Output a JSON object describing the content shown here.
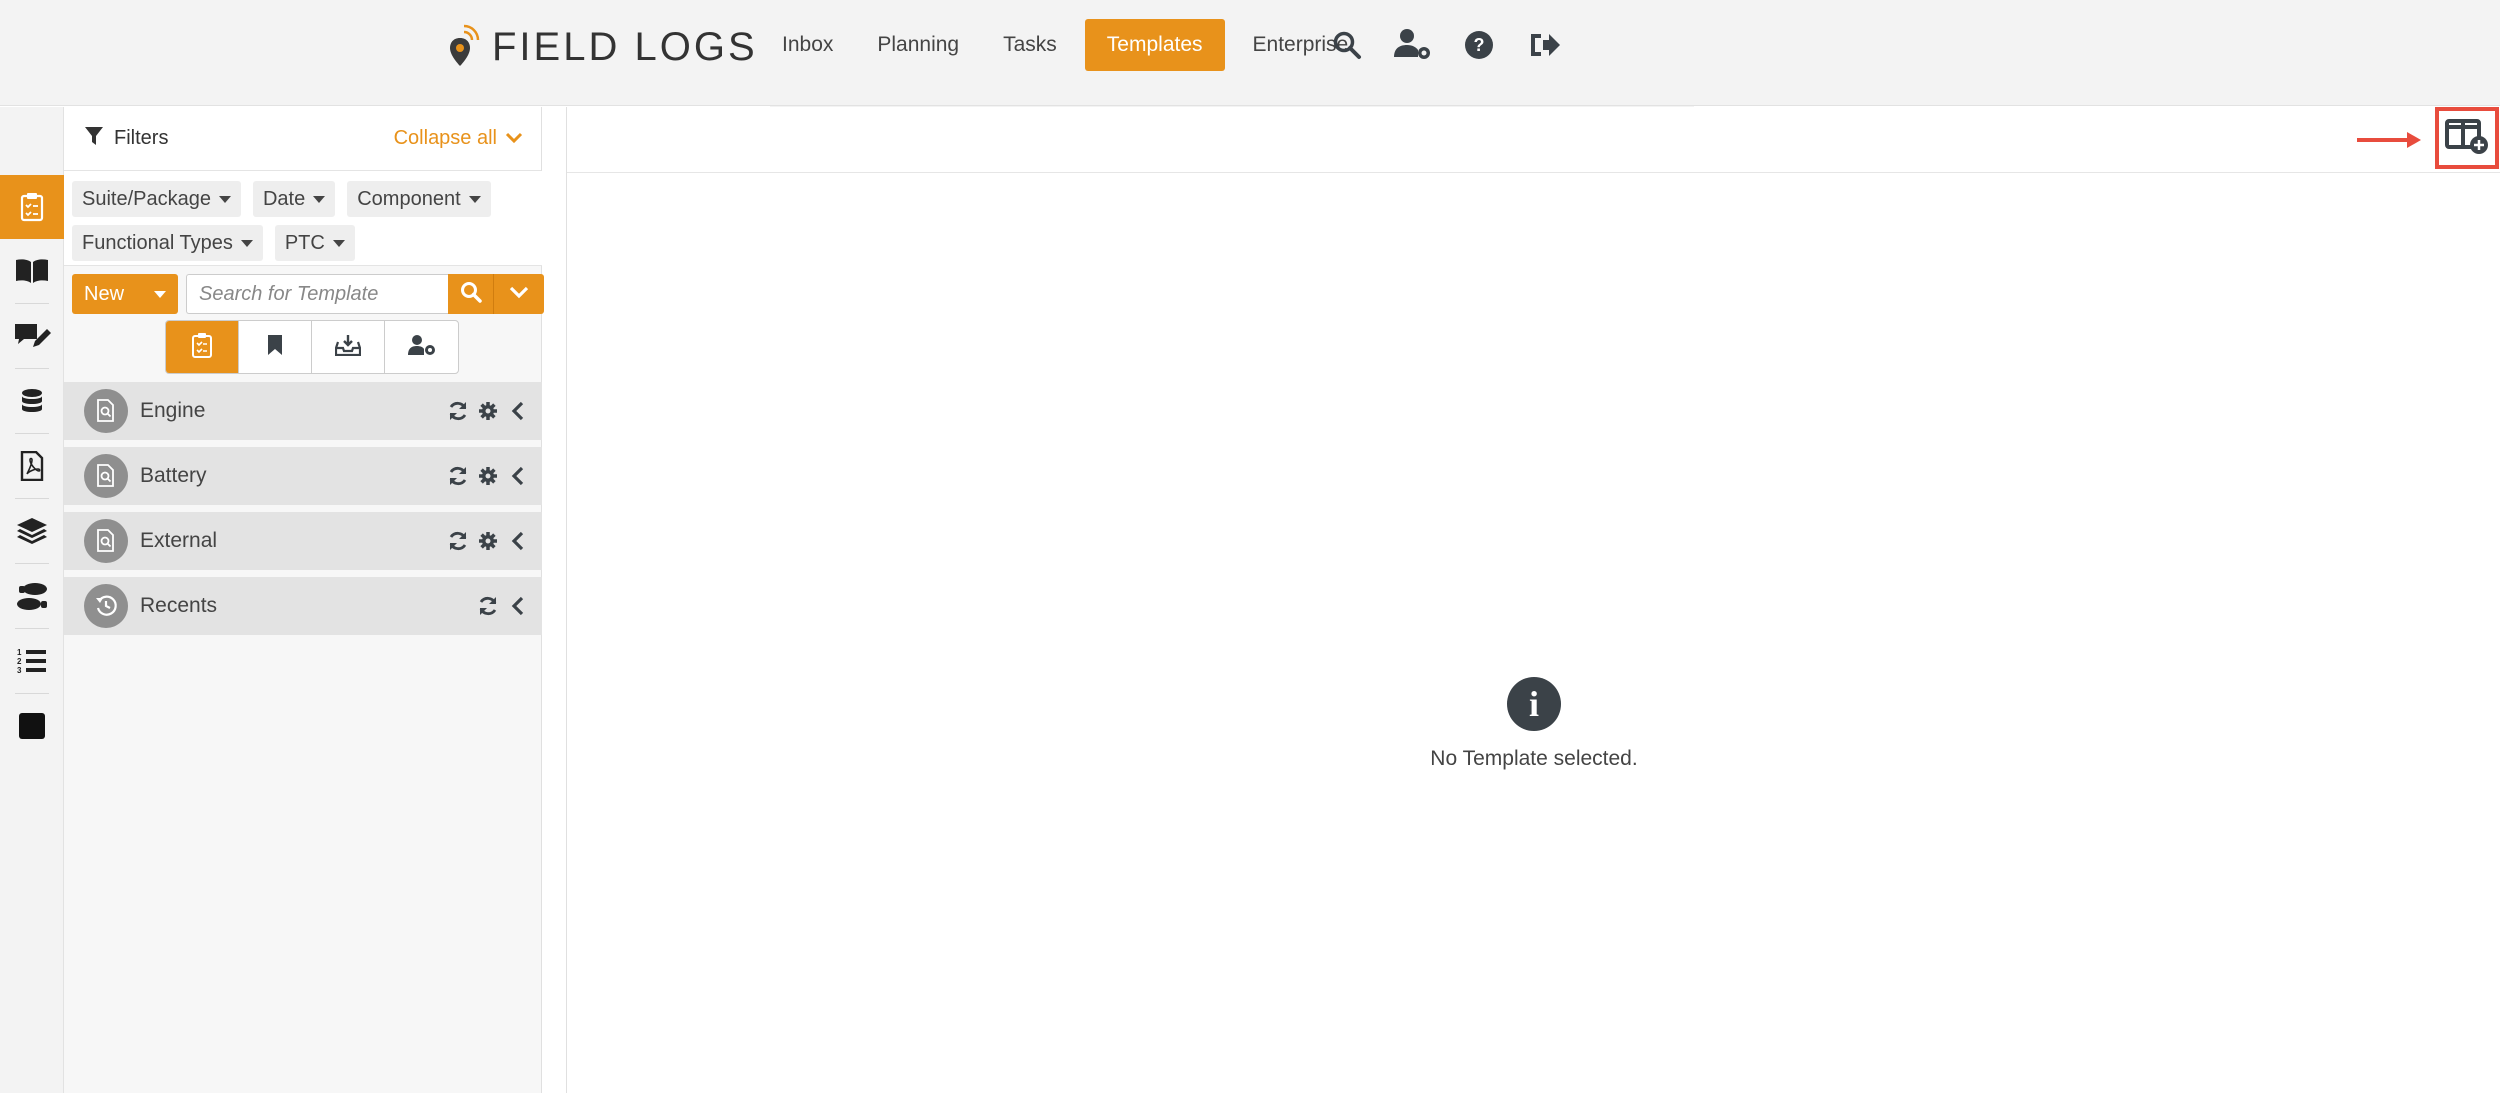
{
  "app": {
    "logo_text": "FIELD LOGS"
  },
  "nav": {
    "items": [
      {
        "label": "Inbox"
      },
      {
        "label": "Planning"
      },
      {
        "label": "Tasks"
      },
      {
        "label": "Templates",
        "active": true
      },
      {
        "label": "Enterprise"
      }
    ],
    "icons": [
      "search-icon",
      "user-settings-icon",
      "help-icon",
      "logout-icon"
    ]
  },
  "sidebar": {
    "icons": [
      "clipboard-icon",
      "book-icon",
      "comment-edit-icon",
      "database-icon",
      "pdf-file-icon",
      "layers-icon",
      "footprints-icon",
      "numbered-list-icon",
      "square-icon"
    ],
    "active_index": 0
  },
  "filters": {
    "title": "Filters",
    "collapse_label": "Collapse all",
    "chips": [
      {
        "label": "Suite/Package"
      },
      {
        "label": "Date"
      },
      {
        "label": "Component"
      },
      {
        "label": "Functional Types"
      },
      {
        "label": "PTC"
      }
    ]
  },
  "search": {
    "new_label": "New",
    "placeholder": "Search for Template"
  },
  "view_tabs": [
    "clipboard-icon",
    "bookmark-icon",
    "inbox-download-icon",
    "user-cog-icon"
  ],
  "tree": {
    "items": [
      {
        "label": "Engine",
        "icon": "file-search-icon"
      },
      {
        "label": "Battery",
        "icon": "file-search-icon"
      },
      {
        "label": "External",
        "icon": "file-search-icon"
      },
      {
        "label": "Recents",
        "icon": "history-icon"
      }
    ]
  },
  "main": {
    "empty_message": "No Template selected.",
    "info_glyph": "i"
  },
  "colors": {
    "accent": "#e8921b",
    "highlight": "#e84c3d",
    "dark": "#3b4248"
  }
}
